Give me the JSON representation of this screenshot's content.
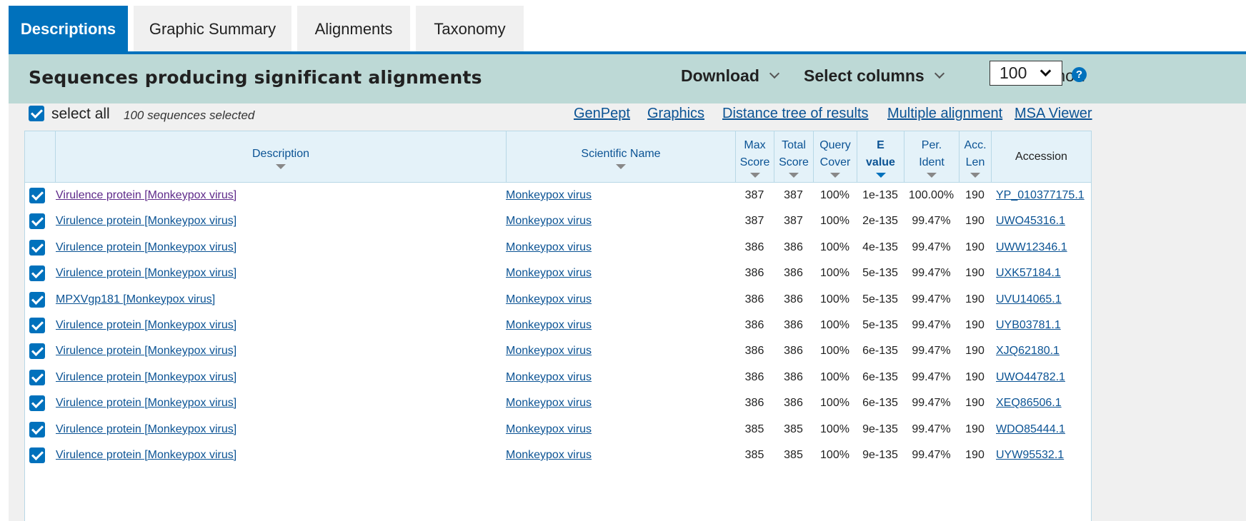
{
  "tabs": [
    {
      "label": "Descriptions",
      "active": true
    },
    {
      "label": "Graphic Summary",
      "active": false
    },
    {
      "label": "Alignments",
      "active": false
    },
    {
      "label": "Taxonomy",
      "active": false
    }
  ],
  "header": {
    "title": "Sequences producing significant alignments",
    "download_label": "Download",
    "select_columns_label": "Select columns",
    "show_label": "Show",
    "show_value": "100",
    "help_icon": "?"
  },
  "toolbar": {
    "select_all_label": "select all",
    "selected_count": "100 sequences selected",
    "links": [
      "GenPept",
      "Graphics",
      "Distance tree of results",
      "Multiple alignment",
      "MSA Viewer"
    ]
  },
  "table": {
    "columns": {
      "description": "Description",
      "scientific_name": "Scientific Name",
      "max_score": [
        "Max",
        "Score"
      ],
      "total_score": [
        "Total",
        "Score"
      ],
      "query_cover": [
        "Query",
        "Cover"
      ],
      "e_value": [
        "E",
        "value"
      ],
      "per_ident": [
        "Per.",
        "Ident"
      ],
      "acc_len": [
        "Acc.",
        "Len"
      ],
      "accession": "Accession"
    },
    "rows": [
      {
        "description": "Virulence protein [Monkeypox virus]",
        "scientific_name": "Monkeypox virus",
        "max_score": "387",
        "total_score": "387",
        "query_cover": "100%",
        "e_value": "1e-135",
        "per_ident": "100.00%",
        "acc_len": "190",
        "accession": "YP_010377175.1",
        "visited": true
      },
      {
        "description": "Virulence protein [Monkeypox virus]",
        "scientific_name": "Monkeypox virus",
        "max_score": "387",
        "total_score": "387",
        "query_cover": "100%",
        "e_value": "2e-135",
        "per_ident": "99.47%",
        "acc_len": "190",
        "accession": "UWO45316.1",
        "visited": false
      },
      {
        "description": "Virulence protein [Monkeypox virus]",
        "scientific_name": "Monkeypox virus",
        "max_score": "386",
        "total_score": "386",
        "query_cover": "100%",
        "e_value": "4e-135",
        "per_ident": "99.47%",
        "acc_len": "190",
        "accession": "UWW12346.1",
        "visited": false
      },
      {
        "description": "Virulence protein [Monkeypox virus]",
        "scientific_name": "Monkeypox virus",
        "max_score": "386",
        "total_score": "386",
        "query_cover": "100%",
        "e_value": "5e-135",
        "per_ident": "99.47%",
        "acc_len": "190",
        "accession": "UXK57184.1",
        "visited": false
      },
      {
        "description": "MPXVgp181 [Monkeypox virus]",
        "scientific_name": "Monkeypox virus",
        "max_score": "386",
        "total_score": "386",
        "query_cover": "100%",
        "e_value": "5e-135",
        "per_ident": "99.47%",
        "acc_len": "190",
        "accession": "UVU14065.1",
        "visited": false
      },
      {
        "description": "Virulence protein [Monkeypox virus]",
        "scientific_name": "Monkeypox virus",
        "max_score": "386",
        "total_score": "386",
        "query_cover": "100%",
        "e_value": "5e-135",
        "per_ident": "99.47%",
        "acc_len": "190",
        "accession": "UYB03781.1",
        "visited": false
      },
      {
        "description": "Virulence protein [Monkeypox virus]",
        "scientific_name": "Monkeypox virus",
        "max_score": "386",
        "total_score": "386",
        "query_cover": "100%",
        "e_value": "6e-135",
        "per_ident": "99.47%",
        "acc_len": "190",
        "accession": "XJQ62180.1",
        "visited": false
      },
      {
        "description": "Virulence protein [Monkeypox virus]",
        "scientific_name": "Monkeypox virus",
        "max_score": "386",
        "total_score": "386",
        "query_cover": "100%",
        "e_value": "6e-135",
        "per_ident": "99.47%",
        "acc_len": "190",
        "accession": "UWO44782.1",
        "visited": false
      },
      {
        "description": "Virulence protein [Monkeypox virus]",
        "scientific_name": "Monkeypox virus",
        "max_score": "386",
        "total_score": "386",
        "query_cover": "100%",
        "e_value": "6e-135",
        "per_ident": "99.47%",
        "acc_len": "190",
        "accession": "XEQ86506.1",
        "visited": false
      },
      {
        "description": "Virulence protein [Monkeypox virus]",
        "scientific_name": "Monkeypox virus",
        "max_score": "385",
        "total_score": "385",
        "query_cover": "100%",
        "e_value": "9e-135",
        "per_ident": "99.47%",
        "acc_len": "190",
        "accession": "WDO85444.1",
        "visited": false
      },
      {
        "description": "Virulence protein [Monkeypox virus]",
        "scientific_name": "Monkeypox virus",
        "max_score": "385",
        "total_score": "385",
        "query_cover": "100%",
        "e_value": "9e-135",
        "per_ident": "99.47%",
        "acc_len": "190",
        "accession": "UYW95532.1",
        "visited": false
      }
    ]
  },
  "colors": {
    "accent": "#0071bc",
    "header_band": "#bdd9d6",
    "link": "#0b5394",
    "visited_link": "#5e2a8a"
  }
}
